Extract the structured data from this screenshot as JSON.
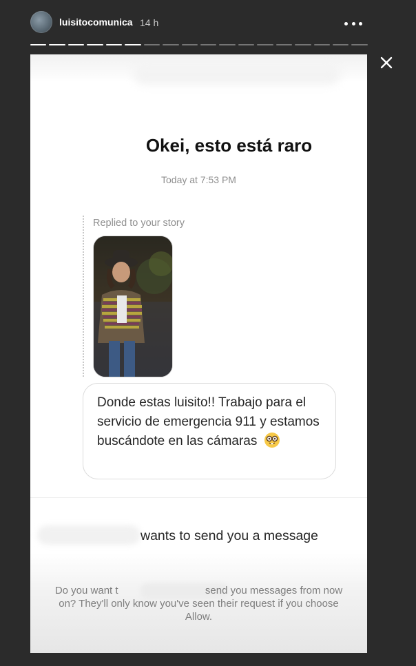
{
  "header": {
    "username": "luisitocomunica",
    "time_ago": "14 h",
    "progress_total": 18,
    "progress_done": 6
  },
  "story": {
    "headline": "Okei, esto está raro",
    "timestamp": "Today at 7:53 PM",
    "replied_label": "Replied to your story",
    "message": "Donde estas luisito!! Trabajo para el servicio de emergencia 911 y estamos buscándote en las cámaras",
    "message_emoji": "nerd-face-emoji",
    "request_title": "wants to send you a message",
    "request_text_start": "Do you want t",
    "request_text_rest": "send you messages from now on? They'll only know you've seen their request if you choose Allow."
  },
  "colors": {
    "background": "#2b2b2b",
    "card": "#ffffff",
    "text": "#262626",
    "muted": "#8e8e8e"
  },
  "icons": {
    "close": "close-icon",
    "more": "more-options-icon"
  }
}
